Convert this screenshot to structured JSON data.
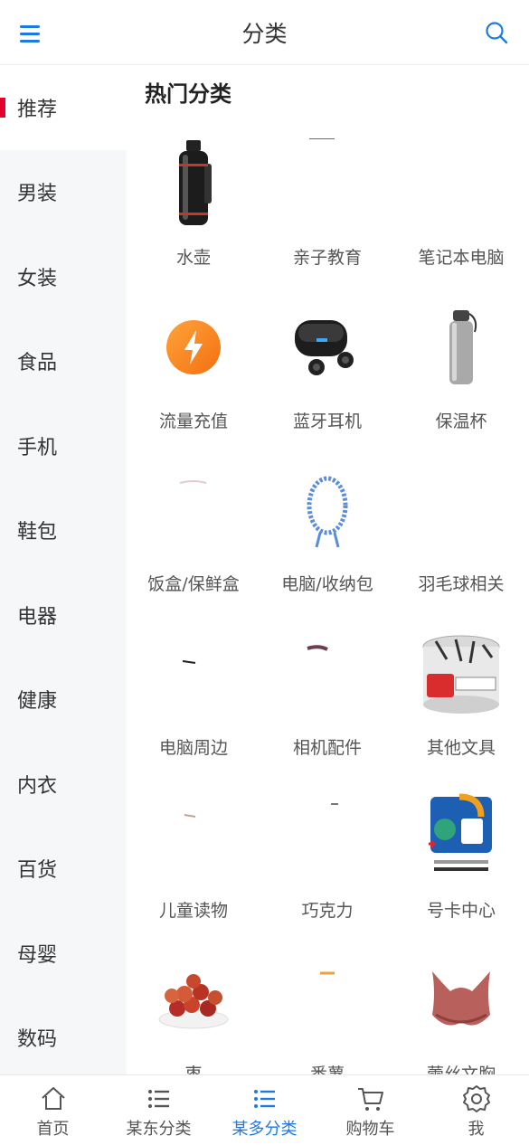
{
  "header": {
    "title": "分类",
    "menu_icon": "menu-icon",
    "search_icon": "search-icon"
  },
  "sidebar": {
    "active_index": 0,
    "items": [
      {
        "label": "推荐"
      },
      {
        "label": "男装"
      },
      {
        "label": "女装"
      },
      {
        "label": "食品"
      },
      {
        "label": "手机"
      },
      {
        "label": "鞋包"
      },
      {
        "label": "电器"
      },
      {
        "label": "健康"
      },
      {
        "label": "内衣"
      },
      {
        "label": "百货"
      },
      {
        "label": "母婴"
      },
      {
        "label": "数码"
      }
    ]
  },
  "main": {
    "section_title": "热门分类",
    "categories": [
      {
        "label": "水壶",
        "icon": "thermos-bottle-icon"
      },
      {
        "label": "亲子教育",
        "icon": "parenting-education-icon"
      },
      {
        "label": "笔记本电脑",
        "icon": "laptop-icon"
      },
      {
        "label": "流量充值",
        "icon": "lightning-bolt-icon"
      },
      {
        "label": "蓝牙耳机",
        "icon": "bluetooth-earbuds-icon"
      },
      {
        "label": "保温杯",
        "icon": "steel-bottle-icon"
      },
      {
        "label": "饭盒/保鲜盒",
        "icon": "lunchbox-icon"
      },
      {
        "label": "电脑/收纳包",
        "icon": "coiled-cable-icon"
      },
      {
        "label": "羽毛球相关",
        "icon": "badminton-icon"
      },
      {
        "label": "电脑周边",
        "icon": "computer-accessory-icon"
      },
      {
        "label": "相机配件",
        "icon": "camera-accessory-icon"
      },
      {
        "label": "其他文具",
        "icon": "binder-clips-jar-icon"
      },
      {
        "label": "儿童读物",
        "icon": "children-book-icon"
      },
      {
        "label": "巧克力",
        "icon": "chocolate-icon"
      },
      {
        "label": "号卡中心",
        "icon": "sim-card-icon"
      },
      {
        "label": "枣",
        "icon": "jujube-plate-icon"
      },
      {
        "label": "番薯",
        "icon": "sweet-potato-icon"
      },
      {
        "label": "蕾丝文胸",
        "icon": "lace-bra-icon"
      }
    ]
  },
  "tabbar": {
    "active_index": 2,
    "accent_color": "#1e7ae0",
    "tabs": [
      {
        "label": "首页",
        "icon": "home-icon"
      },
      {
        "label": "某东分类",
        "icon": "list-icon"
      },
      {
        "label": "某多分类",
        "icon": "list-icon"
      },
      {
        "label": "购物车",
        "icon": "cart-icon"
      },
      {
        "label": "我",
        "icon": "settings-icon"
      }
    ]
  },
  "colors": {
    "accent": "#1e7ae0",
    "active_marker": "#e4002b",
    "sidebar_bg": "#f6f7f9"
  }
}
